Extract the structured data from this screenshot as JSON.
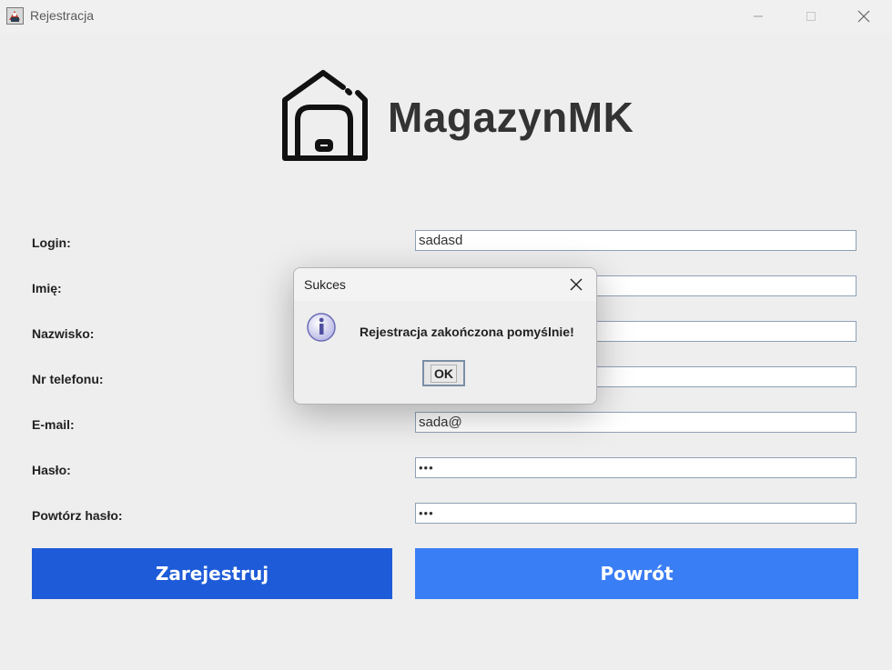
{
  "window": {
    "title": "Rejestracja",
    "icon": "java-app-icon",
    "controls": [
      "minimize-icon",
      "maximize-icon",
      "close-icon"
    ]
  },
  "logo": {
    "text": "MagazynMK",
    "icon": "warehouse-icon"
  },
  "form": {
    "login_label": "Login:",
    "login_value": "sadasd",
    "first_name_label": "Imię:",
    "first_name_value": "",
    "last_name_label": "Nazwisko:",
    "last_name_value": "",
    "phone_label": "Nr telefonu:",
    "phone_value": "",
    "email_label": "E-mail:",
    "email_value": "sada@",
    "password_label": "Hasło:",
    "password_value": "•••",
    "repeat_password_label": "Powtórz hasło:",
    "repeat_password_value": "•••"
  },
  "buttons": {
    "register": "Zarejestruj",
    "back": "Powrót"
  },
  "colors": {
    "register_button": "#1e5bd8",
    "back_button": "#3a7ef5"
  },
  "dialog": {
    "title": "Sukces",
    "icon": "info-icon",
    "message": "Rejestracja zakończona pomyślnie!",
    "ok_label": "OK"
  }
}
